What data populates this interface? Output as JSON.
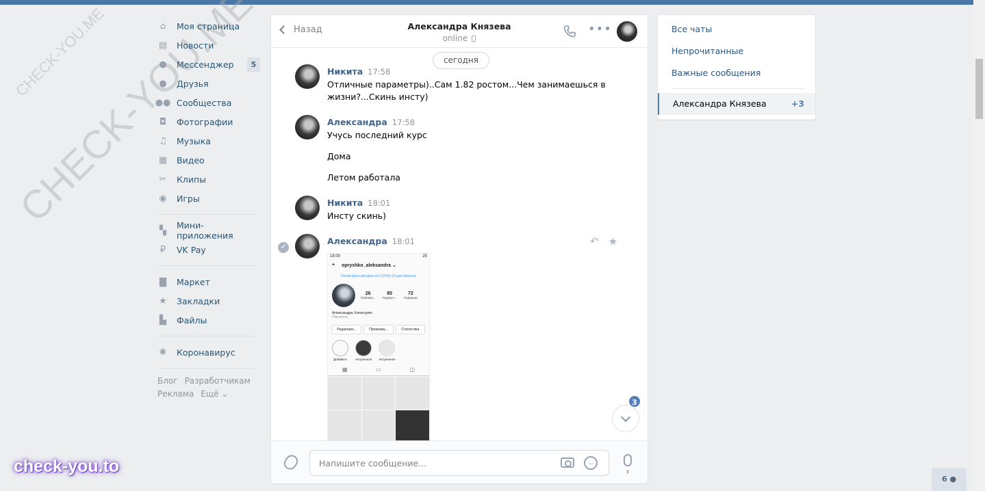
{
  "nav": {
    "items": [
      {
        "label": "Моя страница",
        "icon": "home-icon",
        "glyph": "⌂"
      },
      {
        "label": "Новости",
        "icon": "news-icon",
        "glyph": "▤"
      },
      {
        "label": "Мессенджер",
        "icon": "messenger-icon",
        "glyph": "●",
        "badge": "5"
      },
      {
        "label": "Друзья",
        "icon": "friends-icon",
        "glyph": "●"
      },
      {
        "label": "Сообщества",
        "icon": "communities-icon",
        "glyph": "●●"
      },
      {
        "label": "Фотографии",
        "icon": "photos-icon",
        "glyph": "◘"
      },
      {
        "label": "Музыка",
        "icon": "music-icon",
        "glyph": "♫"
      },
      {
        "label": "Видео",
        "icon": "video-icon",
        "glyph": "▦"
      },
      {
        "label": "Клипы",
        "icon": "clips-icon",
        "glyph": "✂"
      },
      {
        "label": "Игры",
        "icon": "games-icon",
        "glyph": "◉"
      }
    ],
    "items2": [
      {
        "label": "Мини-приложения",
        "icon": "mini-apps-icon",
        "glyph": "▚"
      },
      {
        "label": "VK Pay",
        "icon": "vk-pay-icon",
        "glyph": "₽"
      }
    ],
    "items3": [
      {
        "label": "Маркет",
        "icon": "market-icon",
        "glyph": "▇"
      },
      {
        "label": "Закладки",
        "icon": "bookmarks-icon",
        "glyph": "★"
      },
      {
        "label": "Файлы",
        "icon": "files-icon",
        "glyph": "▙"
      }
    ],
    "items4": [
      {
        "label": "Коронавирус",
        "icon": "coronavirus-icon",
        "glyph": "✺"
      }
    ],
    "footer": [
      "Блог",
      "Разработчикам",
      "Реклама",
      "Ещё ⌄"
    ]
  },
  "watermark": {
    "small": "CHECK-YOU.ME",
    "large": "CHECK-YOU.ME"
  },
  "chat": {
    "back_label": "Назад",
    "peer_name": "Александра Князева",
    "peer_status": "online",
    "date_label": "сегодня",
    "messages": [
      {
        "author": "Никита",
        "time": "17:58",
        "text": "Отличные параметры)..Сам 1.82 ростом...Чем занимаешься в жизни?...Скинь инсту)"
      },
      {
        "author": "Александра",
        "time": "17:58",
        "lines": [
          "Учусь последний курс",
          "Дома",
          "Летом работала"
        ]
      },
      {
        "author": "Никита",
        "time": "18:01",
        "text": "Инсту скинь)"
      },
      {
        "author": "Александра",
        "time": "18:01"
      }
    ],
    "unread_count": "3",
    "composer_placeholder": "Напишите сообщение..."
  },
  "attachment": {
    "status_time": "18:00",
    "status_right": "25",
    "username": "opryshko_aleksandra ⌄",
    "covid_banner": "Посмотрите ресурсы по COVID-19 для бизнеса",
    "stats": [
      {
        "value": "26",
        "label": "Публика..."
      },
      {
        "value": "85",
        "label": "Подписч..."
      },
      {
        "value": "72",
        "label": "Подписки"
      }
    ],
    "full_name": "Александра Хачатурян",
    "bio": "Писатель",
    "buttons": [
      "Редактиро...",
      "Промоакц...",
      "Статистика"
    ],
    "highlights": [
      "Добавить",
      "Актуальное",
      "Актуальное"
    ]
  },
  "right_panel": {
    "items": [
      "Все чаты",
      "Непрочитанные",
      "Важные сообщения"
    ],
    "active_chat": "Александра Князева",
    "active_badge": "+3"
  },
  "brand_watermark": "check-you.to",
  "online_friends": "6"
}
